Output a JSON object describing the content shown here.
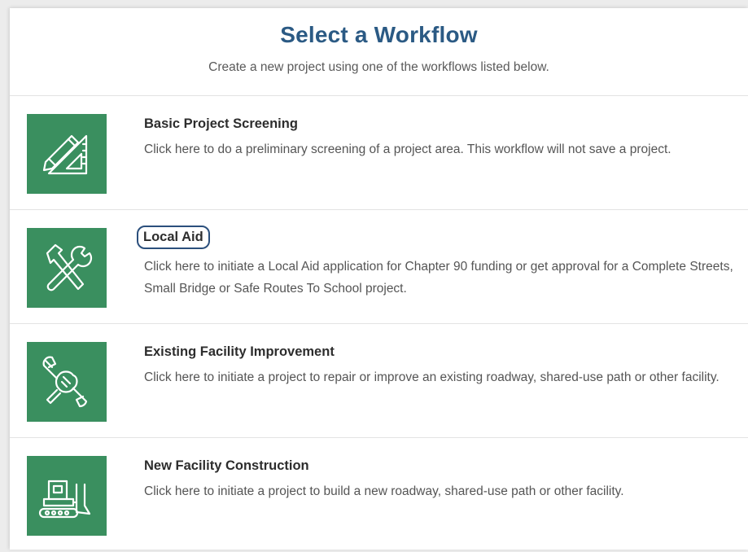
{
  "header": {
    "title": "Select a Workflow",
    "subtitle": "Create a new project using one of the workflows listed below."
  },
  "colors": {
    "title": "#2b5a84",
    "tile": "#3a8f5f",
    "highlight": "#2b4f7c"
  },
  "workflows": [
    {
      "icon": "drafting-tools-icon",
      "name": "Basic Project Screening",
      "description": "Click here to do a preliminary screening of a project area. This workflow will not save a project."
    },
    {
      "icon": "hammer-wrench-icon",
      "name": "Local Aid",
      "description": "Click here to initiate a Local Aid application for Chapter 90 funding or get approval for a Complete Streets, Small Bridge or Safe Routes To School project.",
      "highlighted": true
    },
    {
      "icon": "wrench-fist-icon",
      "name": "Existing Facility Improvement",
      "description": "Click here to initiate a project to repair or improve an existing roadway, shared-use path or other facility."
    },
    {
      "icon": "bulldozer-icon",
      "name": "New Facility Construction",
      "description": "Click here to initiate a project to build a new roadway, shared-use path or other facility."
    }
  ]
}
